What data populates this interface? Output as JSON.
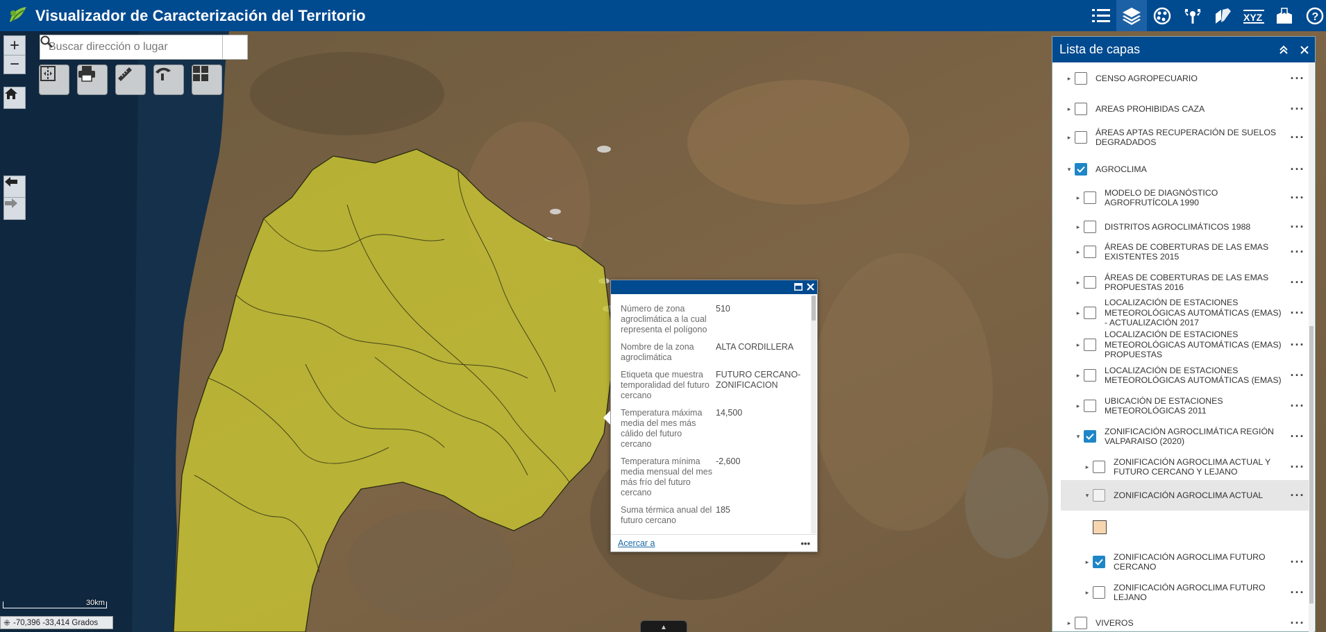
{
  "header": {
    "title": "Visualizador de Caracterización del Territorio",
    "icons": [
      "list-icon",
      "layers-icon",
      "basemap-icon",
      "analysis-icon",
      "draw-icon",
      "xyz-icon",
      "bookmark-icon",
      "help-icon"
    ],
    "colors": {
      "bar": "#004a8f",
      "active": "#1c61a6"
    }
  },
  "search": {
    "placeholder": "Buscar dirección o lugar"
  },
  "popup": {
    "fields": [
      {
        "label": "Número de zona agroclimática a la cual representa el polígono",
        "value": "510"
      },
      {
        "label": "Nombre de la zona agroclimática",
        "value": "ALTA CORDILLERA"
      },
      {
        "label": "Etiqueta que muestra temporalidad del futuro cercano",
        "value": "FUTURO CERCANO-ZONIFICACION"
      },
      {
        "label": "Temperatura máxima media del mes más cálido del futuro cercano",
        "value": "14,500"
      },
      {
        "label": "Temperatura mínima media mensual del mes más frío del futuro cercano",
        "value": "-2,600"
      },
      {
        "label": "Suma térmica anual del futuro cercano",
        "value": "185"
      }
    ],
    "zoom_link": "Acercar a",
    "more": "•••"
  },
  "layers_panel": {
    "title": "Lista de capas",
    "layers": [
      {
        "label": "CENSO AGROPECUARIO",
        "checked": false
      },
      {
        "label": "AREAS PROHIBIDAS CAZA",
        "checked": false
      },
      {
        "label": "ÁREAS APTAS RECUPERACIÓN DE SUELOS DEGRADADOS",
        "checked": false
      },
      {
        "label": "AGROCLIMA",
        "checked": true
      },
      {
        "label": "MODELO DE DIAGNÓSTICO AGROFRUTÍCOLA 1990",
        "checked": false
      },
      {
        "label": "DISTRITOS AGROCLIMÁTICOS 1988",
        "checked": false
      },
      {
        "label": "ÁREAS DE COBERTURAS DE LAS EMAS EXISTENTES 2015",
        "checked": false
      },
      {
        "label": "ÁREAS DE COBERTURAS DE LAS EMAS PROPUESTAS 2016",
        "checked": false
      },
      {
        "label": "LOCALIZACIÓN DE ESTACIONES METEOROLÓGICAS AUTOMÁTICAS (EMAS) - ACTUALIZACIÓN 2017",
        "checked": false
      },
      {
        "label": "LOCALIZACIÓN DE ESTACIONES METEOROLÓGICAS AUTOMÁTICAS (EMAS) PROPUESTAS",
        "checked": false
      },
      {
        "label": "LOCALIZACIÓN DE ESTACIONES METEOROLÓGICAS AUTOMÁTICAS (EMAS)",
        "checked": false
      },
      {
        "label": "UBICACIÓN DE ESTACIONES METEOROLÓGICAS 2011",
        "checked": false
      },
      {
        "label": "ZONIFICACIÓN AGROCLIMÁTICA REGIÓN VALPARAISO (2020)",
        "checked": true
      },
      {
        "label": "ZONIFICACIÓN AGROCLIMA ACTUAL Y FUTURO CERCANO Y LEJANO",
        "checked": false
      },
      {
        "label": "ZONIFICACIÓN AGROCLIMA ACTUAL",
        "checked": false
      },
      {
        "label": "ZONIFICACIÓN AGROCLIMA FUTURO CERCANO",
        "checked": true
      },
      {
        "label": "ZONIFICACIÓN AGROCLIMA FUTURO LEJANO",
        "checked": false
      },
      {
        "label": "VIVEROS",
        "checked": false
      }
    ],
    "legend_color": "#f6d5b0"
  },
  "map": {
    "scale_label": "30km",
    "coordinates": "-70,396 -33,414 Grados",
    "overlay_color": "#c9c832"
  }
}
